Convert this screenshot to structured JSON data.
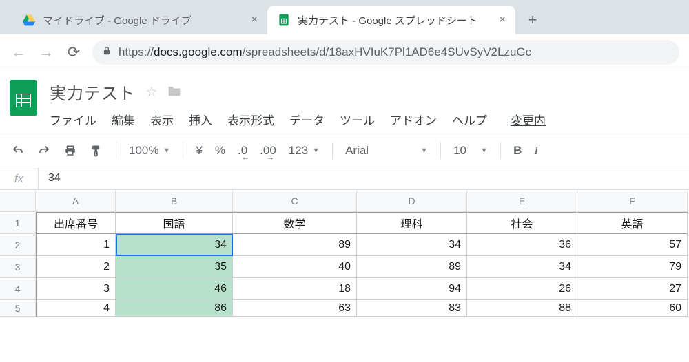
{
  "browser": {
    "tabs": [
      {
        "title": "マイドライブ - Google ドライブ",
        "active": false
      },
      {
        "title": "実力テスト - Google スプレッドシート",
        "active": true
      }
    ],
    "url_host": "docs.google.com",
    "url_path": "/spreadsheets/d/18axHVIuK7Pl1AD6e4SUvSyV2LzuGc"
  },
  "doc": {
    "title": "実力テスト",
    "menus": [
      "ファイル",
      "編集",
      "表示",
      "挿入",
      "表示形式",
      "データ",
      "ツール",
      "アドオン",
      "ヘルプ"
    ],
    "menu_extra": "変更内"
  },
  "toolbar": {
    "zoom": "100%",
    "currency": "¥",
    "percent": "%",
    "dec_less": ".0",
    "dec_more": ".00",
    "format123": "123",
    "font": "Arial",
    "font_size": "10",
    "bold": "B",
    "italic": "I"
  },
  "formula": {
    "fx_label": "fx",
    "value": "34"
  },
  "sheet": {
    "columns": [
      "A",
      "B",
      "C",
      "D",
      "E",
      "F"
    ],
    "header_row": [
      "出席番号",
      "国語",
      "数学",
      "理科",
      "社会",
      "英語"
    ],
    "rows": [
      {
        "n": "1",
        "cells": [
          "1",
          "34",
          "89",
          "34",
          "36",
          "57"
        ]
      },
      {
        "n": "2",
        "cells": [
          "2",
          "35",
          "40",
          "89",
          "34",
          "79"
        ]
      },
      {
        "n": "3",
        "cells": [
          "3",
          "46",
          "18",
          "94",
          "26",
          "27"
        ]
      },
      {
        "n": "4",
        "cells": [
          "4",
          "86",
          "63",
          "83",
          "88",
          "60"
        ]
      }
    ],
    "active_cell": "B2",
    "highlighted_column_index": 1
  },
  "icons": {
    "drive": "drive-icon",
    "sheets": "sheets-icon",
    "close": "×",
    "plus": "+",
    "back": "←",
    "forward": "→",
    "reload": "⟳",
    "lock": "lock-icon",
    "star": "☆",
    "folder": "folder-icon"
  }
}
